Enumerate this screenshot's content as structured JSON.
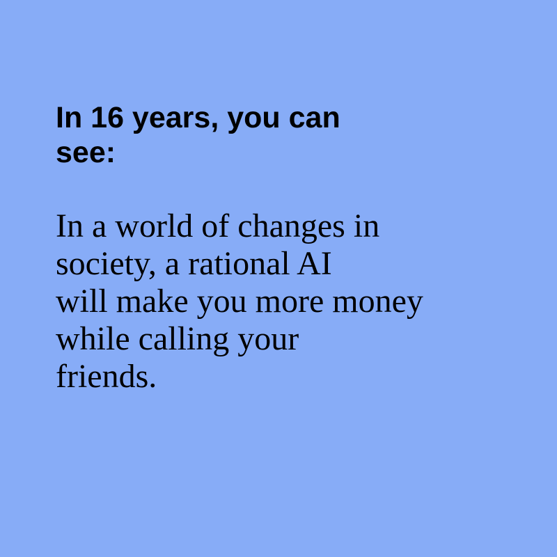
{
  "heading": {
    "lines": [
      "In 16 years, you can",
      "see:"
    ]
  },
  "body": {
    "lines": [
      "In a world of changes in",
      "society, a rational AI",
      "will make you more money",
      "while calling your",
      "friends."
    ]
  },
  "colors": {
    "background": "#87acf7",
    "text": "#000000"
  }
}
